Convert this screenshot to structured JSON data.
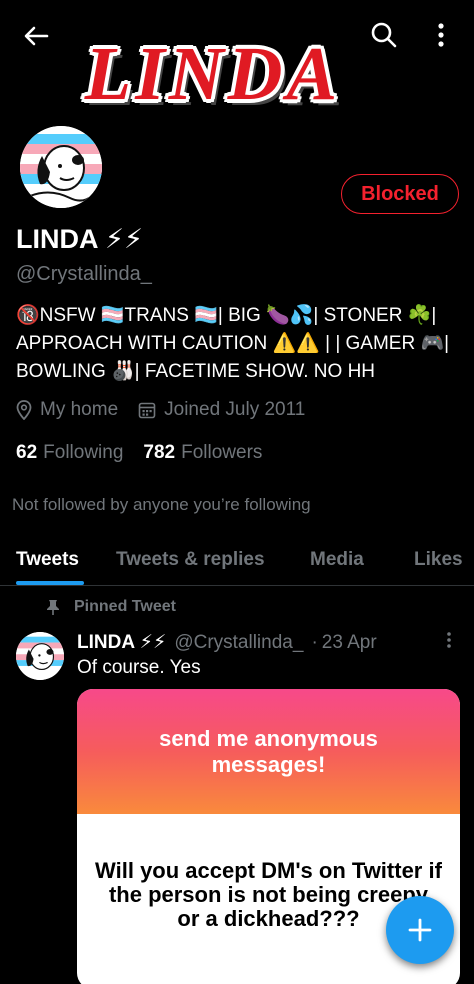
{
  "header": {
    "banner_text": "LINDA",
    "back_icon": "arrow-left-icon",
    "search_icon": "search-icon",
    "more_icon": "more-vertical-icon"
  },
  "profile": {
    "avatar_icon": "snoopy-avatar",
    "blocked_label": "Blocked",
    "name": "LINDA ⚡⚡",
    "handle": "@Crystallinda_",
    "bio_lines": [
      "🔞NSFW 🏳️‍⚧️TRANS 🏳️‍⚧️| BIG 🍆💦| STONER ☘️|",
      "APPROACH WITH CAUTION ⚠️⚠️ | | GAMER 🎮|",
      "BOWLING 🎳| FACETIME SHOW. NO HH"
    ],
    "location": "My home",
    "joined": "Joined July 2011",
    "following_count": "62",
    "following_label": "Following",
    "followers_count": "782",
    "followers_label": "Followers",
    "not_followed": "Not followed by anyone you’re following"
  },
  "tabs": [
    {
      "label": "Tweets",
      "active": true
    },
    {
      "label": "Tweets & replies",
      "active": false
    },
    {
      "label": "Media",
      "active": false
    },
    {
      "label": "Likes",
      "active": false
    }
  ],
  "pinned_tweet": {
    "pinned_label": "Pinned Tweet",
    "name": "LINDA ⚡⚡",
    "handle": "@Crystallinda_",
    "dot": "·",
    "date": "23 Apr",
    "text": "Of course. Yes",
    "card_header": "send me anonymous messages!",
    "card_question": "Will you accept DM's on Twitter if the person is not being creepy or a dickhead???"
  },
  "compose_icon": "plus-icon",
  "colors": {
    "accent": "#1d9bf0",
    "blocked": "#f4212e",
    "muted": "#71767b"
  }
}
